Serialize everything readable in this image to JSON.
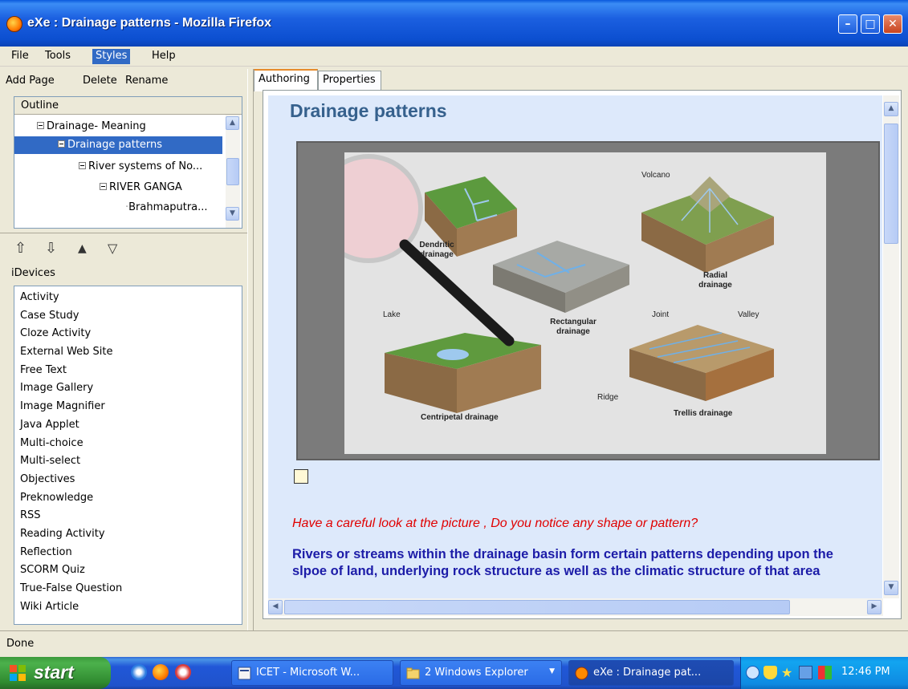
{
  "window": {
    "title": "eXe : Drainage patterns - Mozilla Firefox",
    "controls": {
      "minimize": "–",
      "maximize": "□",
      "close": "✕"
    }
  },
  "menu": [
    "File",
    "Tools",
    "Styles",
    "Help"
  ],
  "left_toolbar": {
    "add_page": "Add Page",
    "delete": "Delete",
    "rename": "Rename"
  },
  "outline": {
    "header": "Outline",
    "items": [
      {
        "label": "Drainage- Meaning",
        "selected": false
      },
      {
        "label": "Drainage patterns",
        "selected": true
      },
      {
        "label": "River systems of No...",
        "selected": false
      },
      {
        "label": "RIVER GANGA",
        "selected": false
      },
      {
        "label": "Brahmaputra...",
        "selected": false
      }
    ]
  },
  "move_buttons": {
    "promote": "⇧",
    "demote": "⇩",
    "up": "▲",
    "down": "▽"
  },
  "idevices": {
    "header": "iDevices",
    "items": [
      "Activity",
      "Case Study",
      "Cloze Activity",
      "External Web Site",
      "Free Text",
      "Image Gallery",
      "Image Magnifier",
      "Java Applet",
      "Multi-choice",
      "Multi-select",
      "Objectives",
      "Preknowledge",
      "RSS",
      "Reading Activity",
      "Reflection",
      "SCORM Quiz",
      "True-False Question",
      "Wiki Article"
    ]
  },
  "tabs": {
    "authoring": "Authoring",
    "properties": "Properties"
  },
  "content": {
    "heading": "Drainage patterns",
    "diagram_labels": {
      "volcano": "Volcano",
      "dendritic": "Dendritic drainage",
      "radial": "Radial drainage",
      "lake": "Lake",
      "rectangular": "Rectangular drainage",
      "joint": "Joint",
      "valley": "Valley",
      "ridge": "Ridge",
      "centripetal": "Centripetal drainage",
      "trellis": "Trellis drainage"
    },
    "question": "Have a careful look at the picture , Do you notice any shape or pattern?",
    "body": "Rivers or streams within the drainage basin form certain patterns depending upon the slpoe of land, underlying rock structure as well as the climatic structure of that area"
  },
  "status": "Done",
  "taskbar": {
    "start": "start",
    "tasks": [
      {
        "label": "ICET - Microsoft W...",
        "active": false
      },
      {
        "label": "2 Windows Explorer",
        "active": false
      },
      {
        "label": "eXe : Drainage pat...",
        "active": true
      }
    ],
    "clock": "12:46 PM"
  },
  "colors": {
    "heading": "#36618d",
    "question": "#e00000",
    "body": "#1c1ca8",
    "selection": "#316ac5"
  }
}
